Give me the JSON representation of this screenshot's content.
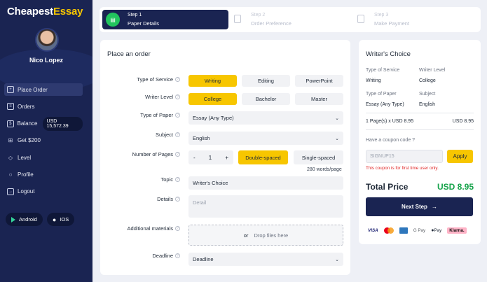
{
  "brand": {
    "name_part1": "Cheapest",
    "name_part2": "Essay"
  },
  "user": {
    "name": "Nico Lopez"
  },
  "sidebar": {
    "items": [
      {
        "label": "Place Order",
        "icon": "plus-square-icon"
      },
      {
        "label": "Orders",
        "icon": "list-icon"
      },
      {
        "label": "Balance",
        "icon": "dollar-icon"
      },
      {
        "label": "Get $200",
        "icon": "gift-icon"
      },
      {
        "label": "Level",
        "icon": "level-icon"
      },
      {
        "label": "Profile",
        "icon": "user-icon"
      },
      {
        "label": "Logout",
        "icon": "logout-icon"
      }
    ],
    "balance_amount": "USD 15,572.39",
    "stores": {
      "android": "Android",
      "ios": "IOS"
    }
  },
  "steps": [
    {
      "number": "Step 1",
      "title": "Paper Details"
    },
    {
      "number": "Step 2",
      "title": "Order Preference"
    },
    {
      "number": "Step 3",
      "title": "Make Payment"
    }
  ],
  "order": {
    "title": "Place an order",
    "labels": {
      "service": "Type of Service",
      "level": "Writer Level",
      "paper": "Type of Paper",
      "subject": "Subject",
      "pages": "Number of Pages",
      "topic": "Topic",
      "details": "Details",
      "materials": "Additional materials",
      "deadline": "Deadline"
    },
    "service_options": [
      "Writing",
      "Editing",
      "PowerPoint"
    ],
    "level_options": [
      "College",
      "Bachelor",
      "Master"
    ],
    "paper_value": "Essay (Any Type)",
    "subject_value": "English",
    "pages": {
      "minus": "-",
      "value": "1",
      "plus": "+",
      "double": "Double-spaced",
      "single": "Single-spaced",
      "words": "280 words/page"
    },
    "topic_value": "Writer's Choice",
    "details_placeholder": "Detail",
    "dropzone": {
      "or": "or",
      "text": "Drop files here"
    },
    "deadline_value": "Deadline"
  },
  "summary": {
    "title": "Writer's Choice",
    "service_label": "Type of Service",
    "service_value": "Writing",
    "level_label": "Writer Level",
    "level_value": "College",
    "paper_label": "Type of Paper",
    "paper_value": "Essay (Any Type)",
    "subject_label": "Subject",
    "subject_value": "English",
    "pages_line": "1 Page(s) x USD 8.95",
    "pages_total": "USD 8.95",
    "coupon_question": "Have a coupon code ?",
    "coupon_placeholder": "SIGNUP15",
    "apply": "Apply",
    "coupon_note": "This coupon is for first time user only.",
    "total_label": "Total Price",
    "total_value": "USD 8.95",
    "next": "Next Step",
    "payments": [
      "VISA",
      "G Pay",
      "Pay",
      "Klarna."
    ]
  },
  "colors": {
    "sidebar": "#1a2452",
    "accent": "#f7c600",
    "success": "#16a34a"
  }
}
